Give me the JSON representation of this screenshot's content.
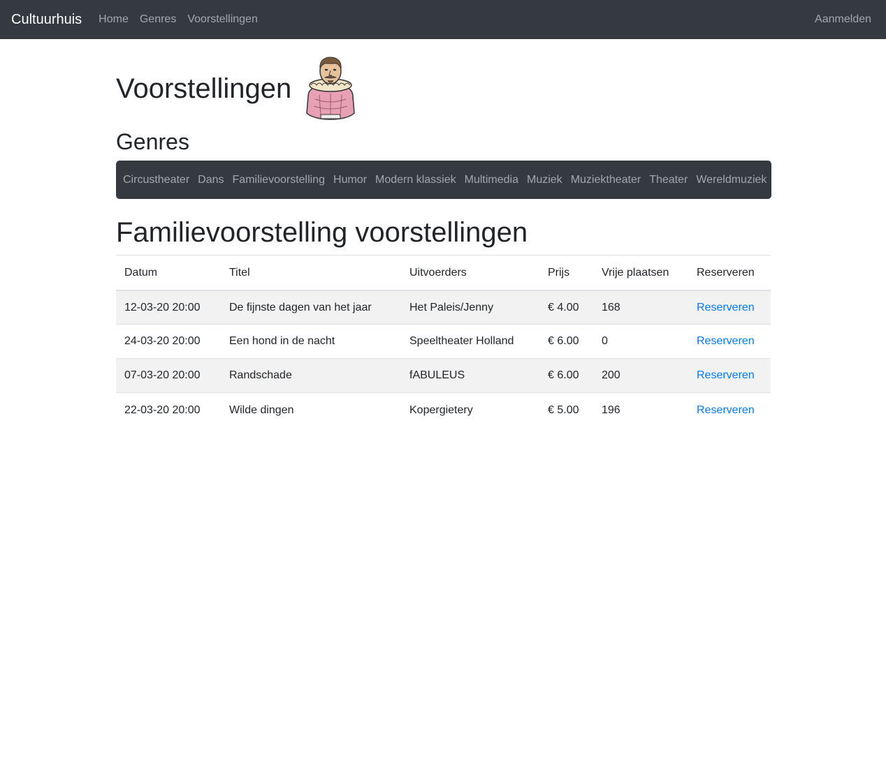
{
  "navbar": {
    "brand": "Cultuurhuis",
    "links": [
      "Home",
      "Genres",
      "Voorstellingen"
    ],
    "login": "Aanmelden"
  },
  "header": {
    "title": "Voorstellingen"
  },
  "genres": {
    "title": "Genres",
    "items": [
      "Circustheater",
      "Dans",
      "Familievoorstelling",
      "Humor",
      "Modern klassiek",
      "Multimedia",
      "Muziek",
      "Muziektheater",
      "Theater",
      "Wereldmuziek"
    ]
  },
  "section": {
    "title": "Familievoorstelling voorstellingen"
  },
  "table": {
    "headers": [
      "Datum",
      "Titel",
      "Uitvoerders",
      "Prijs",
      "Vrije plaatsen",
      "Reserveren"
    ],
    "rows": [
      {
        "datum": "12-03-20 20:00",
        "titel": "De fijnste dagen van het jaar",
        "uitvoerders": "Het Paleis/Jenny",
        "prijs": "€ 4.00",
        "vrij": "168",
        "reserveren": "Reserveren"
      },
      {
        "datum": "24-03-20 20:00",
        "titel": "Een hond in de nacht",
        "uitvoerders": "Speeltheater Holland",
        "prijs": "€ 6.00",
        "vrij": "0",
        "reserveren": "Reserveren"
      },
      {
        "datum": "07-03-20 20:00",
        "titel": "Randschade",
        "uitvoerders": "fABULEUS",
        "prijs": "€ 6.00",
        "vrij": "200",
        "reserveren": "Reserveren"
      },
      {
        "datum": "22-03-20 20:00",
        "titel": "Wilde dingen",
        "uitvoerders": "Kopergietery",
        "prijs": "€ 5.00",
        "vrij": "196",
        "reserveren": "Reserveren"
      }
    ]
  },
  "colors": {
    "navbar_bg": "#343a40",
    "link": "#007bff",
    "stripe": "#f2f2f2"
  },
  "icons": {
    "mascot": "shakespeare-bust-icon"
  }
}
